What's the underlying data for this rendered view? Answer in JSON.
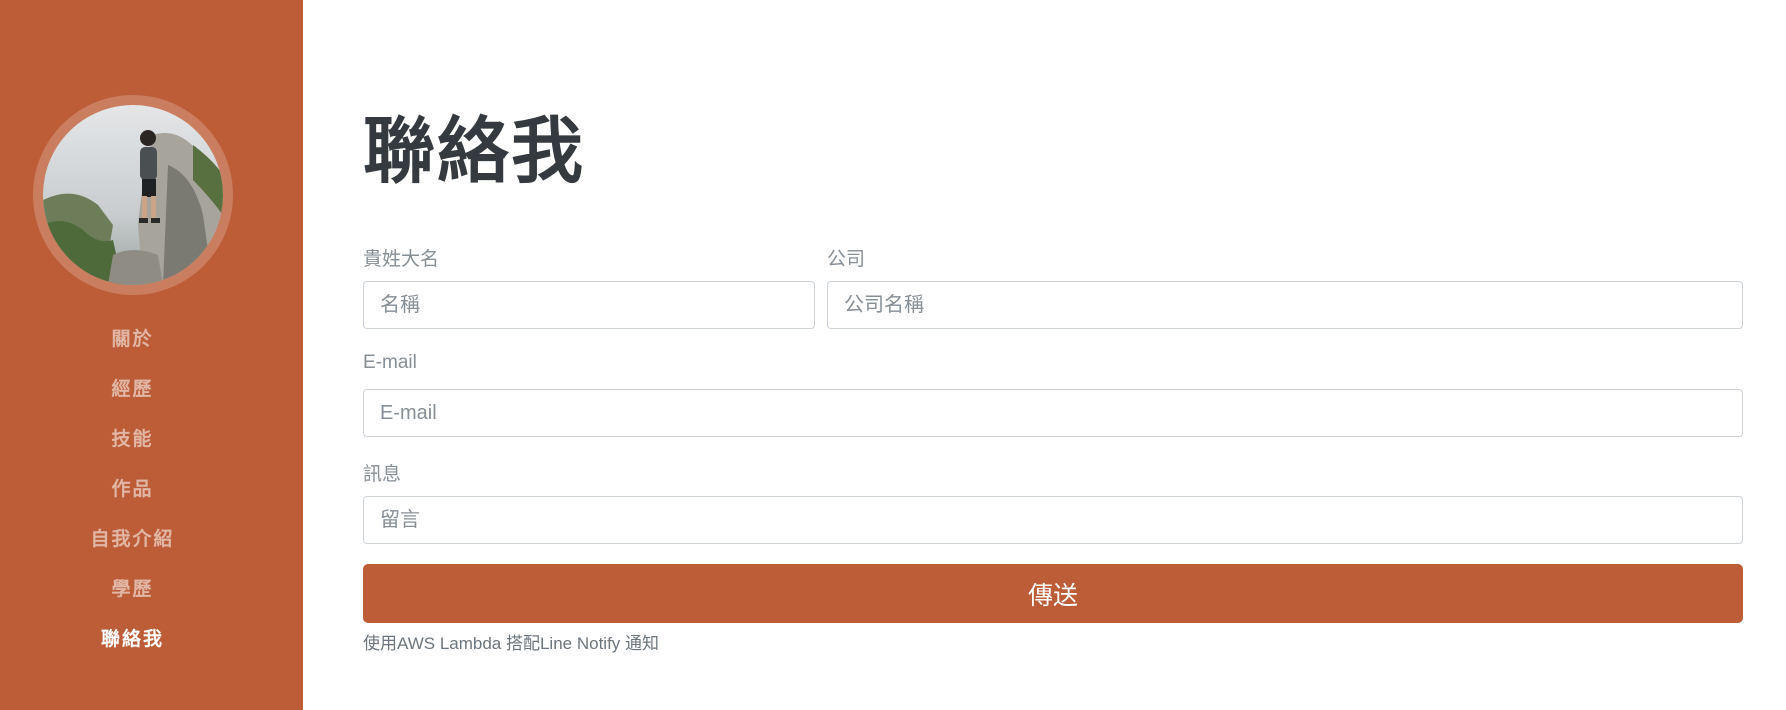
{
  "nav": {
    "items": [
      {
        "label": "關於"
      },
      {
        "label": "經歷"
      },
      {
        "label": "技能"
      },
      {
        "label": "作品"
      },
      {
        "label": "自我介紹"
      },
      {
        "label": "學歷"
      },
      {
        "label": "聯絡我"
      }
    ],
    "active": "聯絡我"
  },
  "contact": {
    "title": "聯絡我",
    "name_label": "貴姓大名",
    "name_placeholder": "名稱",
    "company_label": "公司",
    "company_placeholder": "公司名稱",
    "email_label": "E-mail",
    "email_placeholder": "E-mail",
    "message_label": "訊息",
    "message_placeholder": "留言",
    "submit_label": "傳送",
    "note": "使用AWS Lambda 搭配Line Notify 通知"
  },
  "colors": {
    "primary": "#bd5d38",
    "heading": "#343a40",
    "label": "#868e96"
  }
}
